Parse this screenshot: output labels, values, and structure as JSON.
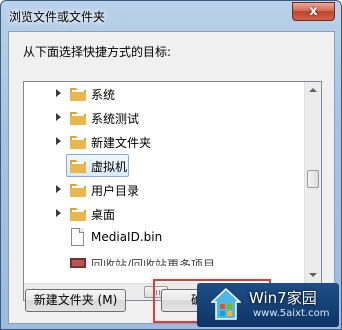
{
  "window": {
    "title": "浏览文件或文件夹",
    "close_symbol": "x"
  },
  "instruction": "从下面选择快捷方式的目标:",
  "tree": {
    "items": [
      {
        "label": "系统",
        "type": "folder",
        "expandable": true,
        "selected": false
      },
      {
        "label": "系统测试",
        "type": "folder",
        "expandable": true,
        "selected": false
      },
      {
        "label": "新建文件夹",
        "type": "folder",
        "expandable": true,
        "selected": false
      },
      {
        "label": "虚拟机",
        "type": "folder",
        "expandable": false,
        "selected": true
      },
      {
        "label": "用户目录",
        "type": "folder",
        "expandable": true,
        "selected": false
      },
      {
        "label": "桌面",
        "type": "folder",
        "expandable": true,
        "selected": false
      },
      {
        "label": "MediaID.bin",
        "type": "file",
        "expandable": false,
        "selected": false
      }
    ],
    "partial_item_label": "回收站/回收站更多项目"
  },
  "buttons": {
    "new_folder": "新建文件夹 (M)",
    "ok": "确"
  },
  "watermark": {
    "title": "Win7家园",
    "url": "www.5aixt.com"
  },
  "colors": {
    "accent_frame": "#3d5a80",
    "selection_border": "#84acdd",
    "highlight_box": "#e33a3a",
    "close_button": "#c0442a",
    "folder": "#e8b64a"
  }
}
